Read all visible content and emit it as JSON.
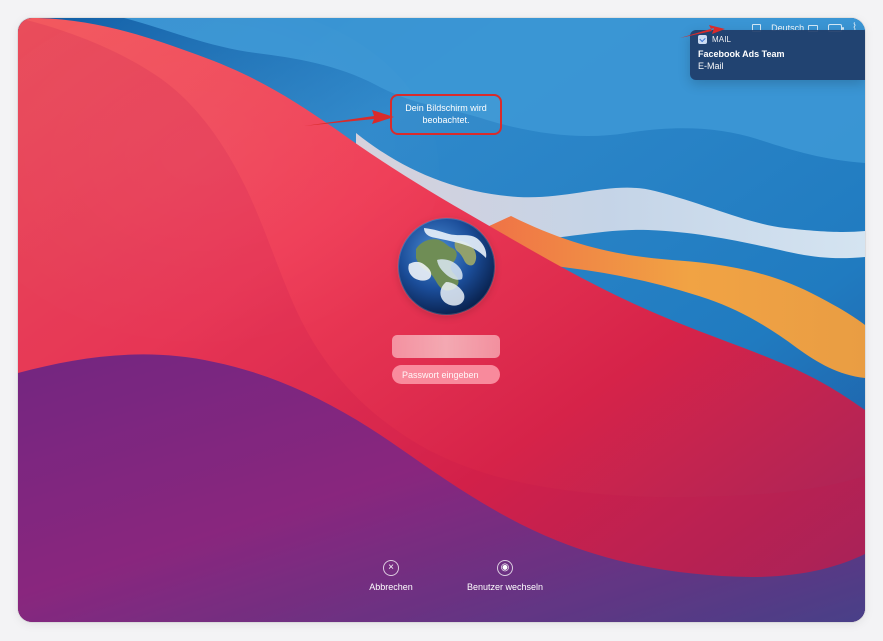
{
  "menubar": {
    "language": "Deutsch"
  },
  "notification": {
    "app": "MAIL",
    "sender": "Facebook Ads Team",
    "subject": "E-Mail"
  },
  "status_message": "Dein Bildschirm wird beobachtet.",
  "login": {
    "password_placeholder": "Passwort eingeben"
  },
  "actions": {
    "cancel": "Abbrechen",
    "switch_user": "Benutzer wechseln"
  },
  "colors": {
    "annotation_red": "#d92b2b",
    "notification_bg": "#1f3c68",
    "password_pill": "#ffa2b0"
  },
  "icons": {
    "menubar_window": "window-icon",
    "keyboard": "keyboard-icon",
    "battery": "battery-icon",
    "wifi": "wifi-icon",
    "mail": "mail-icon",
    "cancel": "cancel-icon",
    "user_switch": "user-switch-icon",
    "avatar": "earth-avatar"
  }
}
